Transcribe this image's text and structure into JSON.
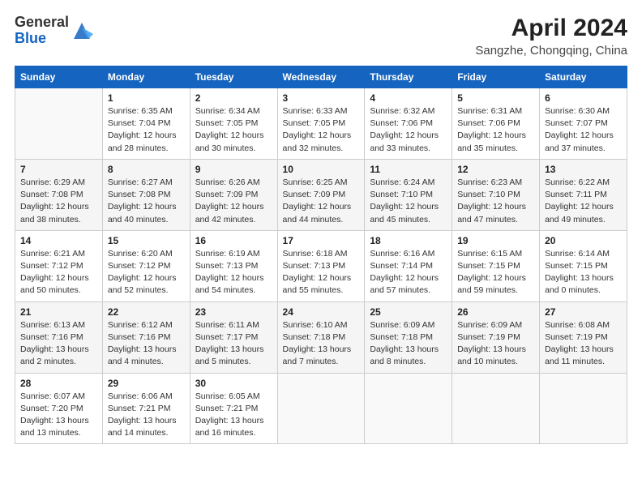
{
  "header": {
    "logo_general": "General",
    "logo_blue": "Blue",
    "month_year": "April 2024",
    "location": "Sangzhe, Chongqing, China"
  },
  "days_of_week": [
    "Sunday",
    "Monday",
    "Tuesday",
    "Wednesday",
    "Thursday",
    "Friday",
    "Saturday"
  ],
  "weeks": [
    [
      {
        "day": "",
        "info": ""
      },
      {
        "day": "1",
        "info": "Sunrise: 6:35 AM\nSunset: 7:04 PM\nDaylight: 12 hours\nand 28 minutes."
      },
      {
        "day": "2",
        "info": "Sunrise: 6:34 AM\nSunset: 7:05 PM\nDaylight: 12 hours\nand 30 minutes."
      },
      {
        "day": "3",
        "info": "Sunrise: 6:33 AM\nSunset: 7:05 PM\nDaylight: 12 hours\nand 32 minutes."
      },
      {
        "day": "4",
        "info": "Sunrise: 6:32 AM\nSunset: 7:06 PM\nDaylight: 12 hours\nand 33 minutes."
      },
      {
        "day": "5",
        "info": "Sunrise: 6:31 AM\nSunset: 7:06 PM\nDaylight: 12 hours\nand 35 minutes."
      },
      {
        "day": "6",
        "info": "Sunrise: 6:30 AM\nSunset: 7:07 PM\nDaylight: 12 hours\nand 37 minutes."
      }
    ],
    [
      {
        "day": "7",
        "info": "Sunrise: 6:29 AM\nSunset: 7:08 PM\nDaylight: 12 hours\nand 38 minutes."
      },
      {
        "day": "8",
        "info": "Sunrise: 6:27 AM\nSunset: 7:08 PM\nDaylight: 12 hours\nand 40 minutes."
      },
      {
        "day": "9",
        "info": "Sunrise: 6:26 AM\nSunset: 7:09 PM\nDaylight: 12 hours\nand 42 minutes."
      },
      {
        "day": "10",
        "info": "Sunrise: 6:25 AM\nSunset: 7:09 PM\nDaylight: 12 hours\nand 44 minutes."
      },
      {
        "day": "11",
        "info": "Sunrise: 6:24 AM\nSunset: 7:10 PM\nDaylight: 12 hours\nand 45 minutes."
      },
      {
        "day": "12",
        "info": "Sunrise: 6:23 AM\nSunset: 7:10 PM\nDaylight: 12 hours\nand 47 minutes."
      },
      {
        "day": "13",
        "info": "Sunrise: 6:22 AM\nSunset: 7:11 PM\nDaylight: 12 hours\nand 49 minutes."
      }
    ],
    [
      {
        "day": "14",
        "info": "Sunrise: 6:21 AM\nSunset: 7:12 PM\nDaylight: 12 hours\nand 50 minutes."
      },
      {
        "day": "15",
        "info": "Sunrise: 6:20 AM\nSunset: 7:12 PM\nDaylight: 12 hours\nand 52 minutes."
      },
      {
        "day": "16",
        "info": "Sunrise: 6:19 AM\nSunset: 7:13 PM\nDaylight: 12 hours\nand 54 minutes."
      },
      {
        "day": "17",
        "info": "Sunrise: 6:18 AM\nSunset: 7:13 PM\nDaylight: 12 hours\nand 55 minutes."
      },
      {
        "day": "18",
        "info": "Sunrise: 6:16 AM\nSunset: 7:14 PM\nDaylight: 12 hours\nand 57 minutes."
      },
      {
        "day": "19",
        "info": "Sunrise: 6:15 AM\nSunset: 7:15 PM\nDaylight: 12 hours\nand 59 minutes."
      },
      {
        "day": "20",
        "info": "Sunrise: 6:14 AM\nSunset: 7:15 PM\nDaylight: 13 hours\nand 0 minutes."
      }
    ],
    [
      {
        "day": "21",
        "info": "Sunrise: 6:13 AM\nSunset: 7:16 PM\nDaylight: 13 hours\nand 2 minutes."
      },
      {
        "day": "22",
        "info": "Sunrise: 6:12 AM\nSunset: 7:16 PM\nDaylight: 13 hours\nand 4 minutes."
      },
      {
        "day": "23",
        "info": "Sunrise: 6:11 AM\nSunset: 7:17 PM\nDaylight: 13 hours\nand 5 minutes."
      },
      {
        "day": "24",
        "info": "Sunrise: 6:10 AM\nSunset: 7:18 PM\nDaylight: 13 hours\nand 7 minutes."
      },
      {
        "day": "25",
        "info": "Sunrise: 6:09 AM\nSunset: 7:18 PM\nDaylight: 13 hours\nand 8 minutes."
      },
      {
        "day": "26",
        "info": "Sunrise: 6:09 AM\nSunset: 7:19 PM\nDaylight: 13 hours\nand 10 minutes."
      },
      {
        "day": "27",
        "info": "Sunrise: 6:08 AM\nSunset: 7:19 PM\nDaylight: 13 hours\nand 11 minutes."
      }
    ],
    [
      {
        "day": "28",
        "info": "Sunrise: 6:07 AM\nSunset: 7:20 PM\nDaylight: 13 hours\nand 13 minutes."
      },
      {
        "day": "29",
        "info": "Sunrise: 6:06 AM\nSunset: 7:21 PM\nDaylight: 13 hours\nand 14 minutes."
      },
      {
        "day": "30",
        "info": "Sunrise: 6:05 AM\nSunset: 7:21 PM\nDaylight: 13 hours\nand 16 minutes."
      },
      {
        "day": "",
        "info": ""
      },
      {
        "day": "",
        "info": ""
      },
      {
        "day": "",
        "info": ""
      },
      {
        "day": "",
        "info": ""
      }
    ]
  ]
}
